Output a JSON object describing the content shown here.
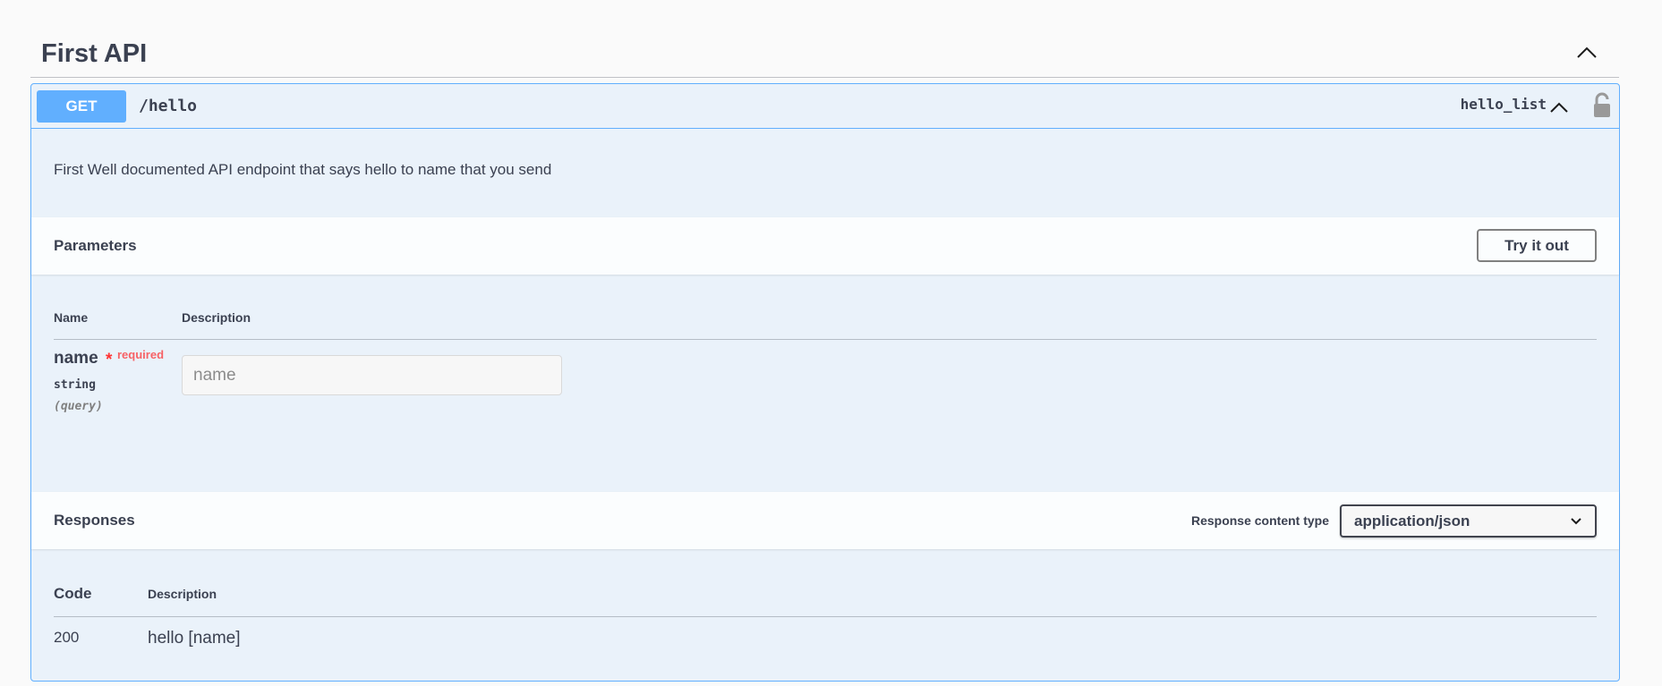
{
  "tag": {
    "title": "First API"
  },
  "operation": {
    "method": "GET",
    "path": "/hello",
    "operation_id": "hello_list",
    "description": "First Well documented API endpoint that says hello to name that you send"
  },
  "parameters": {
    "title": "Parameters",
    "try_label": "Try it out",
    "col_name": "Name",
    "col_description": "Description",
    "items": [
      {
        "name": "name",
        "required_star": "*",
        "required_label": "required",
        "type": "string",
        "in": "(query)",
        "placeholder": "name"
      }
    ]
  },
  "responses": {
    "title": "Responses",
    "content_type_label": "Response content type",
    "content_type_value": "application/json",
    "col_code": "Code",
    "col_description": "Description",
    "rows": [
      {
        "code": "200",
        "description": "hello [name]"
      }
    ]
  },
  "colors": {
    "get_accent": "#61afe9",
    "text": "#3b4151",
    "required": "#ff3333"
  }
}
